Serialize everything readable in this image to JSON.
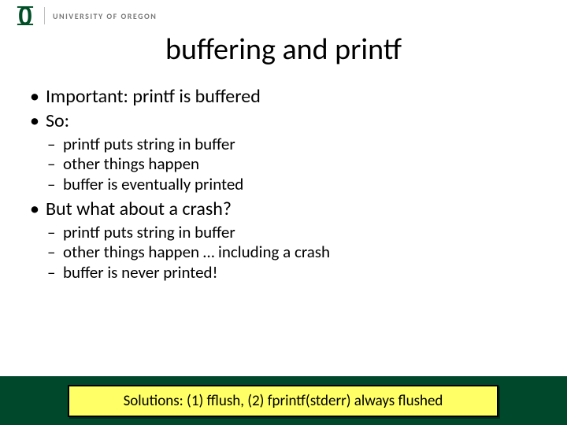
{
  "header": {
    "org_text": "UNIVERSITY OF OREGON",
    "logo_color": "#004f27"
  },
  "title": "buffering and printf",
  "bullets": [
    {
      "text": "Important: printf is buffered",
      "children": []
    },
    {
      "text": "So:",
      "children": [
        "printf puts string in buffer",
        "other things happen",
        "buffer is eventually printed"
      ]
    },
    {
      "text": "But what about a crash?",
      "children": [
        "printf puts string in buffer",
        "other things happen … including a crash",
        "buffer is never printed!"
      ]
    }
  ],
  "solution": "Solutions: (1) fflush, (2) fprintf(stderr) always flushed"
}
